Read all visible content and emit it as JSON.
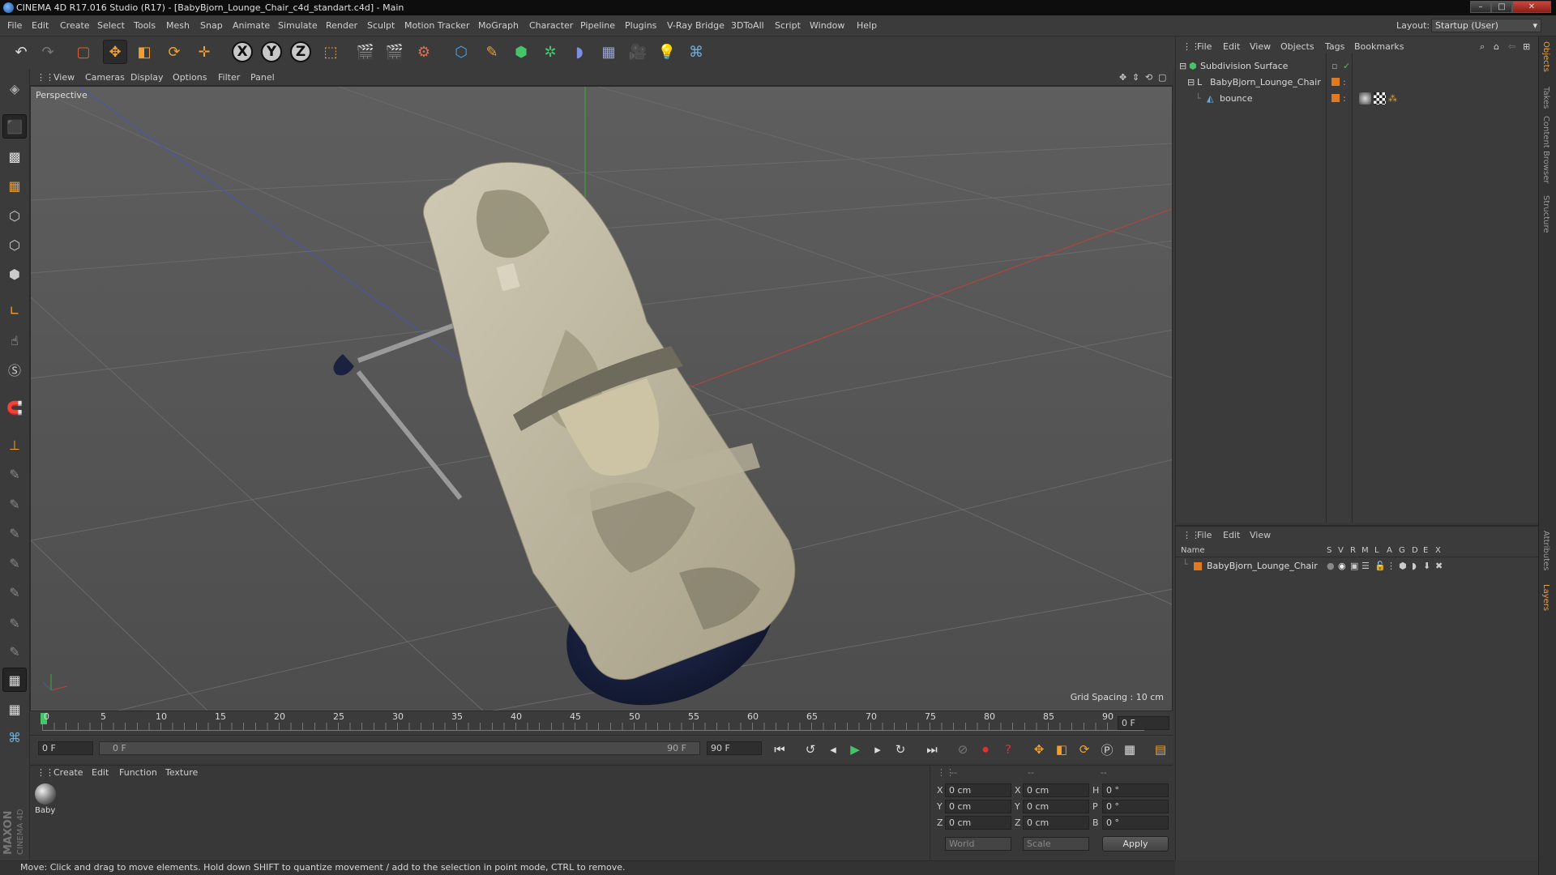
{
  "window": {
    "title": "CINEMA 4D R17.016 Studio (R17) - [BabyBjorn_Lounge_Chair_c4d_standart.c4d] - Main",
    "min": "–",
    "max": "□",
    "close": "✕"
  },
  "menu": [
    "File",
    "Edit",
    "Create",
    "Select",
    "Tools",
    "Mesh",
    "Snap",
    "Animate",
    "Simulate",
    "Render",
    "Sculpt",
    "Motion Tracker",
    "MoGraph",
    "Character",
    "Pipeline",
    "Plugins",
    "V-Ray Bridge",
    "3DToAll",
    "Script",
    "Window",
    "Help"
  ],
  "layout": {
    "label": "Layout:",
    "value": "Startup (User)"
  },
  "toolbar": {
    "undo_icon": "undo-icon",
    "redo_icon": "redo-icon",
    "x": "X",
    "y": "Y",
    "z": "Z"
  },
  "viewport": {
    "menu": [
      "View",
      "Cameras",
      "Display",
      "Options",
      "Filter",
      "Panel"
    ],
    "label": "Perspective",
    "grid_spacing": "Grid Spacing : 10 cm"
  },
  "timeline": {
    "ticks": [
      "0",
      "5",
      "10",
      "15",
      "20",
      "25",
      "30",
      "35",
      "40",
      "45",
      "50",
      "55",
      "60",
      "65",
      "70",
      "75",
      "80",
      "85",
      "90"
    ],
    "current_frame": "0 F"
  },
  "playbar": {
    "start": "0 F",
    "range_start": "0 F",
    "range_end": "90 F",
    "end": "90 F"
  },
  "materials": {
    "menu": [
      "Create",
      "Edit",
      "Function",
      "Texture"
    ],
    "items": [
      {
        "name": "Baby"
      }
    ]
  },
  "coords": {
    "headers": [
      "--",
      "--",
      "--"
    ],
    "rows": [
      {
        "axis": "X",
        "pos": "0 cm",
        "axis2": "X",
        "size": "0 cm",
        "rot_axis": "H",
        "rot": "0 °"
      },
      {
        "axis": "Y",
        "pos": "0 cm",
        "axis2": "Y",
        "size": "0 cm",
        "rot_axis": "P",
        "rot": "0 °"
      },
      {
        "axis": "Z",
        "pos": "0 cm",
        "axis2": "Z",
        "size": "0 cm",
        "rot_axis": "B",
        "rot": "0 °"
      }
    ],
    "world": "World",
    "scale": "Scale",
    "apply": "Apply"
  },
  "status": "Move: Click and drag to move elements. Hold down SHIFT to quantize movement / add to the selection in point mode, CTRL to remove.",
  "objects": {
    "menu": [
      "File",
      "Edit",
      "View",
      "Objects",
      "Tags",
      "Bookmarks"
    ],
    "items": [
      {
        "name": "Subdivision Surface"
      },
      {
        "name": "BabyBjorn_Lounge_Chair"
      },
      {
        "name": "bounce"
      }
    ]
  },
  "layers": {
    "menu": [
      "File",
      "Edit",
      "View"
    ],
    "columns": [
      "Name",
      "S",
      "V",
      "R",
      "M",
      "L",
      "A",
      "G",
      "D",
      "E",
      "X"
    ],
    "items": [
      {
        "name": "BabyBjorn_Lounge_Chair",
        "color": "#e07a20"
      }
    ]
  },
  "sidetabs": [
    "Objects",
    "Takes",
    "Content Browser",
    "Structure",
    "Attributes",
    "Layers"
  ],
  "brand": {
    "line1": "MAXON",
    "line2": "CINEMA 4D"
  },
  "colors": {
    "accent": "#f0a030",
    "layer": "#e07a20",
    "fabric": "#c7c0a8",
    "base": "#1a2340"
  }
}
